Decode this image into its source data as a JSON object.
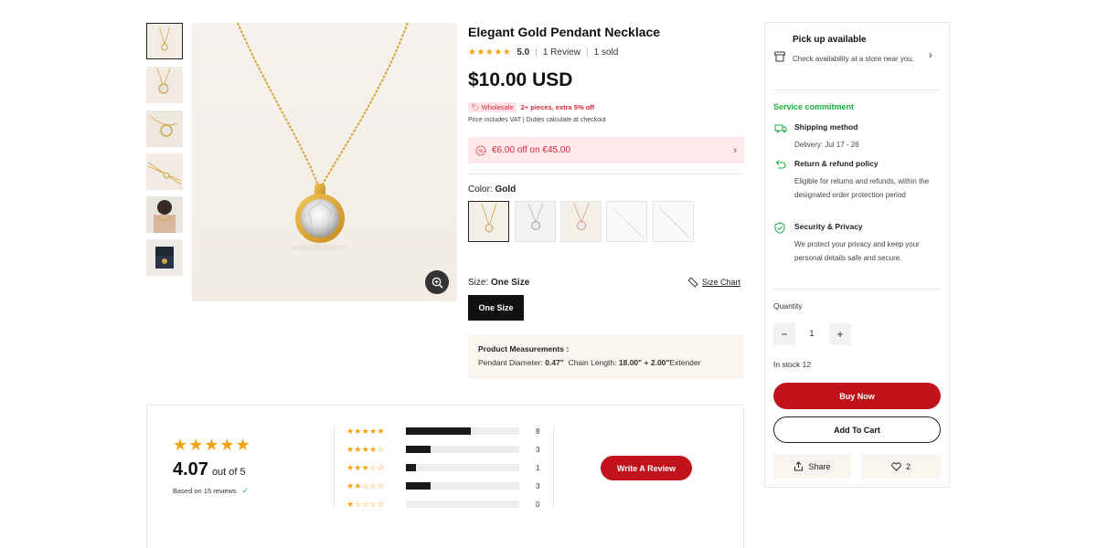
{
  "product": {
    "title": "Elegant Gold Pendant Necklace",
    "stars": "★★★★★",
    "rating": "5.0",
    "reviews": "1 Review",
    "sold": "1 sold",
    "price": "$10.00 USD",
    "wholesale_badge": "Wholesale",
    "wholesale_text": "2+ pieces, extra 5% off",
    "vat_note": "Price includes VAT | Duties calculate at checkout",
    "promo": "€6.00 off on €45.00",
    "color_label": "Color:",
    "color_value": "Gold",
    "size_label": "Size:",
    "size_value": "One Size",
    "size_chart": "Size Chart",
    "size_option": "One Size",
    "measure_title": "Product Measurements :",
    "measure_pd_label": "Pendant Diameter:",
    "measure_pd_value": "0.47\"",
    "measure_cl_label": "Chain Length:",
    "measure_cl_value": "18.00\" + 2.00\"",
    "measure_ext": "Extender"
  },
  "panel": {
    "pickup_title": "Pick up available",
    "pickup_text": "Check availability at a store near you.",
    "service_title": "Service commitment",
    "shipping_title": "Shipping method",
    "shipping_text": "Delivery: Jul 17 - 26",
    "return_title": "Return & refund policy",
    "return_text": "Eligible for returns and refunds, within the designated order protection period",
    "security_title": "Security & Privacy",
    "security_text": "We protect your privacy and keep your personal details safe and secure.",
    "quantity_label": "Quantity",
    "qty_minus": "−",
    "qty_value": "1",
    "qty_plus": "+",
    "stock": "In stock 12",
    "buy_now": "Buy Now",
    "add_to_cart": "Add To Cart",
    "share": "Share",
    "likes": "2"
  },
  "reviews": {
    "stars": "★★★★★",
    "average": "4.07",
    "out_of": "out of 5",
    "based_on": "Based on 15 reviews",
    "write_review": "Write A Review",
    "rows": [
      {
        "stars": "★★★★★",
        "count": "8",
        "fraction": 0.57
      },
      {
        "stars": "★★★★☆",
        "count": "3",
        "fraction": 0.22
      },
      {
        "stars": "★★★☆☆",
        "count": "1",
        "fraction": 0.09
      },
      {
        "stars": "★★☆☆☆",
        "count": "3",
        "fraction": 0.22
      },
      {
        "stars": "★☆☆☆☆",
        "count": "0",
        "fraction": 0.0
      }
    ]
  },
  "colors": {
    "accent_red": "#c2121c",
    "service_green": "#1cae3b",
    "star_gold": "#f3a20f"
  }
}
